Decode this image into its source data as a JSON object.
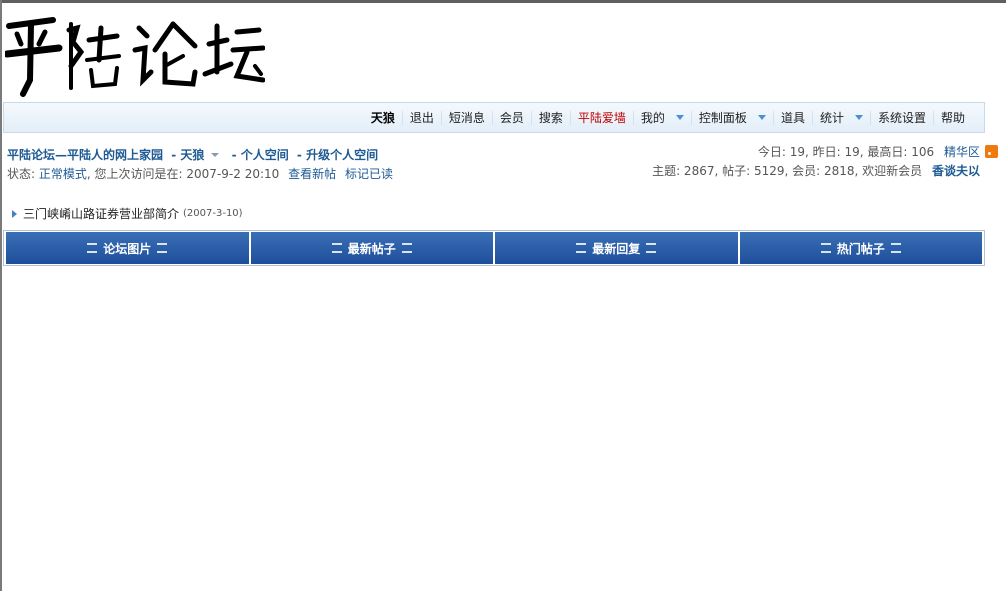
{
  "logo": {
    "text": "平陆论坛"
  },
  "nav": {
    "user": "天狼",
    "items": [
      "退出",
      "短消息",
      "会员",
      "搜索",
      "平陆爱墙",
      "我的",
      "控制面板",
      "道具",
      "统计",
      "系统设置",
      "帮助"
    ]
  },
  "breadcrumb": {
    "forum": "平陆论坛—平陆人的网上家园",
    "user": "- 天狼",
    "space": "- 个人空间",
    "upgrade": "- 升级个人空间"
  },
  "status": {
    "label": "状态:",
    "mode": "正常模式",
    "last_visit_prefix": ", 您上次访问是在:",
    "last_visit": "2007-9-2 20:10",
    "view_new": "查看新帖",
    "mark_read": "标记已读"
  },
  "stats": {
    "today": "今日: 19, 昨日: 19, 最高日: 106",
    "digest": "精华区",
    "totals": "主题: 2867, 帖子: 5129, 会员: 2818, 欢迎新会员",
    "newest_member": "香谈夫以"
  },
  "announcement": {
    "title": "三门峡崤山路证券营业部简介",
    "date": "(2007-3-10)"
  },
  "tabs": [
    "论坛图片",
    "最新帖子",
    "最新回复",
    "热门帖子"
  ],
  "colors": {
    "accent": "#1e5a94",
    "tab_bg": "#2a5ca6",
    "highlight": "#c00000",
    "rss": "#f07a10"
  }
}
